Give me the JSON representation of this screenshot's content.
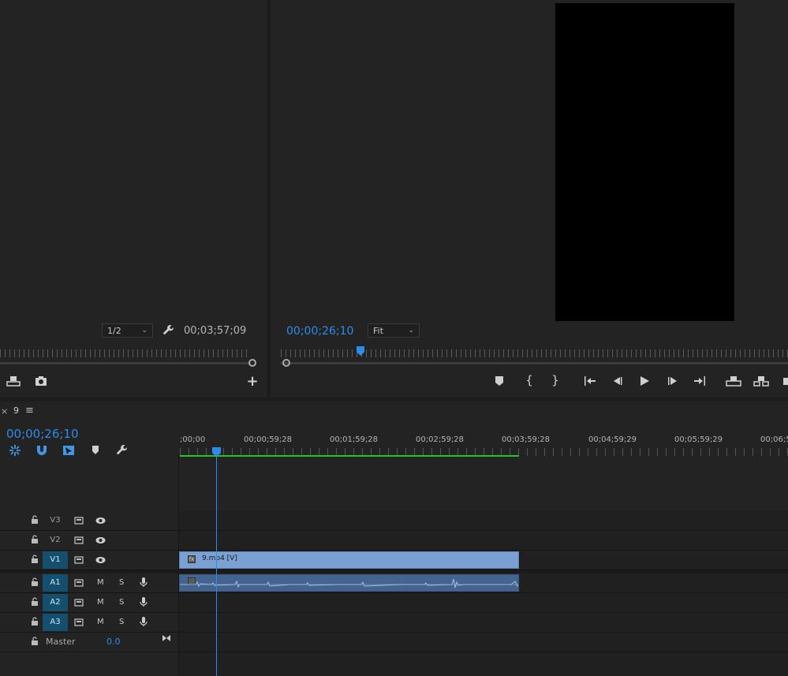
{
  "source_monitor": {
    "resolution": "1/2",
    "duration": "00;03;57;09"
  },
  "program_monitor": {
    "timecode": "00;00;26;10",
    "zoom": "Fit"
  },
  "timeline": {
    "sequence_name": "9",
    "timecode": "00;00;26;10",
    "ruler_labels": [
      ";00;00",
      "00;00;59;28",
      "00;01;59;28",
      "00;02;59;28",
      "00;03;59;28",
      "00;04;59;29",
      "00;05;59;29",
      "00;06;5"
    ],
    "video_tracks": [
      "V3",
      "V2",
      "V1"
    ],
    "audio_tracks": [
      "A1",
      "A2",
      "A3"
    ],
    "mute_label": "M",
    "solo_label": "S",
    "master_label": "Master",
    "master_value": "0.0",
    "clip_name": "9.mp4 [V]"
  },
  "colors": {
    "accent_blue": "#2d8ceb",
    "clip_blue": "#7ba1d4",
    "render_bar_green": "#25c425",
    "track_selected": "#14506e"
  }
}
